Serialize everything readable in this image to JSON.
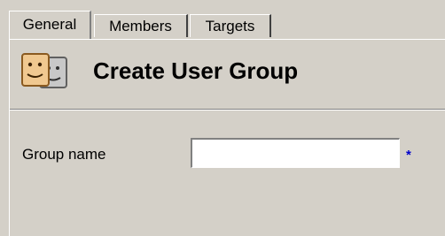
{
  "tabs": [
    {
      "label": "General",
      "active": true
    },
    {
      "label": "Members",
      "active": false
    },
    {
      "label": "Targets",
      "active": false
    }
  ],
  "header": {
    "title": "Create User Group",
    "icon": "user-group-icon"
  },
  "form": {
    "group_name_label": "Group name",
    "group_name_value": "",
    "required_marker": "*"
  },
  "colors": {
    "window_background": "#d4d0c8",
    "required_marker": "#0000cc"
  }
}
